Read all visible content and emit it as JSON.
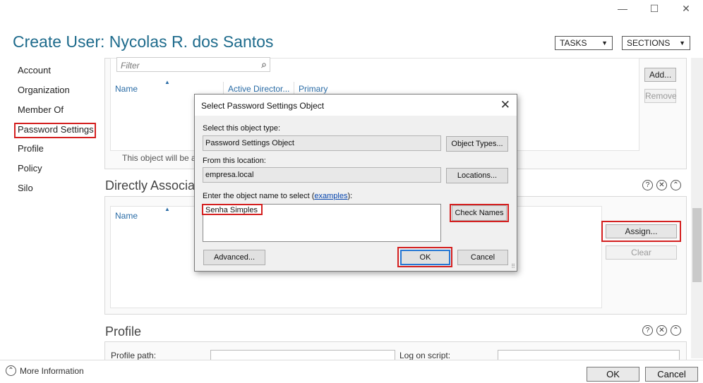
{
  "window": {
    "minimize_glyph": "—",
    "maximize_glyph": "☐",
    "close_glyph": "✕"
  },
  "page_title": "Create User: Nycolas R. dos Santos",
  "header": {
    "tasks_label": "TASKS",
    "sections_label": "SECTIONS",
    "dropdown_glyph": "▼"
  },
  "sidebar": {
    "items": [
      {
        "label": "Account"
      },
      {
        "label": "Organization"
      },
      {
        "label": "Member Of"
      },
      {
        "label": "Password Settings",
        "selected": true
      },
      {
        "label": "Profile"
      },
      {
        "label": "Policy"
      },
      {
        "label": "Silo"
      }
    ]
  },
  "member_of": {
    "filter_placeholder": "Filter",
    "search_icon": "search-icon",
    "columns": [
      "Name",
      "Active Director...",
      "Primary"
    ],
    "note": "This object will be a",
    "add_label": "Add...",
    "remove_label": "Remove"
  },
  "password_settings": {
    "title": "Directly Associat",
    "columns": [
      "Name"
    ],
    "assign_label": "Assign...",
    "clear_label": "Clear",
    "controls": [
      "?",
      "✕",
      "⌃"
    ]
  },
  "profile": {
    "title": "Profile",
    "profile_path_label": "Profile path:",
    "logon_script_label": "Log on script:",
    "controls": [
      "?",
      "✕",
      "⌃"
    ]
  },
  "footer": {
    "more_info_label": "More Information",
    "more_info_glyph": "⌃",
    "ok_label": "OK",
    "cancel_label": "Cancel"
  },
  "dialog": {
    "title": "Select Password Settings Object",
    "close_glyph": "✕",
    "object_type_label": "Select this object type:",
    "object_type_value": "Password Settings Object",
    "object_types_button": "Object Types...",
    "location_label": "From this location:",
    "location_value": "empresa.local",
    "locations_button": "Locations...",
    "enter_name_label_prefix": "Enter the object name to select (",
    "examples_link": "examples",
    "enter_name_label_suffix": "):",
    "object_name_value": "Senha Simples",
    "check_names_button": "Check Names",
    "advanced_button": "Advanced...",
    "ok_button": "OK",
    "cancel_button": "Cancel"
  },
  "colors": {
    "title_blue": "#1e6b8c",
    "highlight_red": "#d42020",
    "link_blue": "#2a6ca6",
    "default_button_border": "#2677d4"
  }
}
